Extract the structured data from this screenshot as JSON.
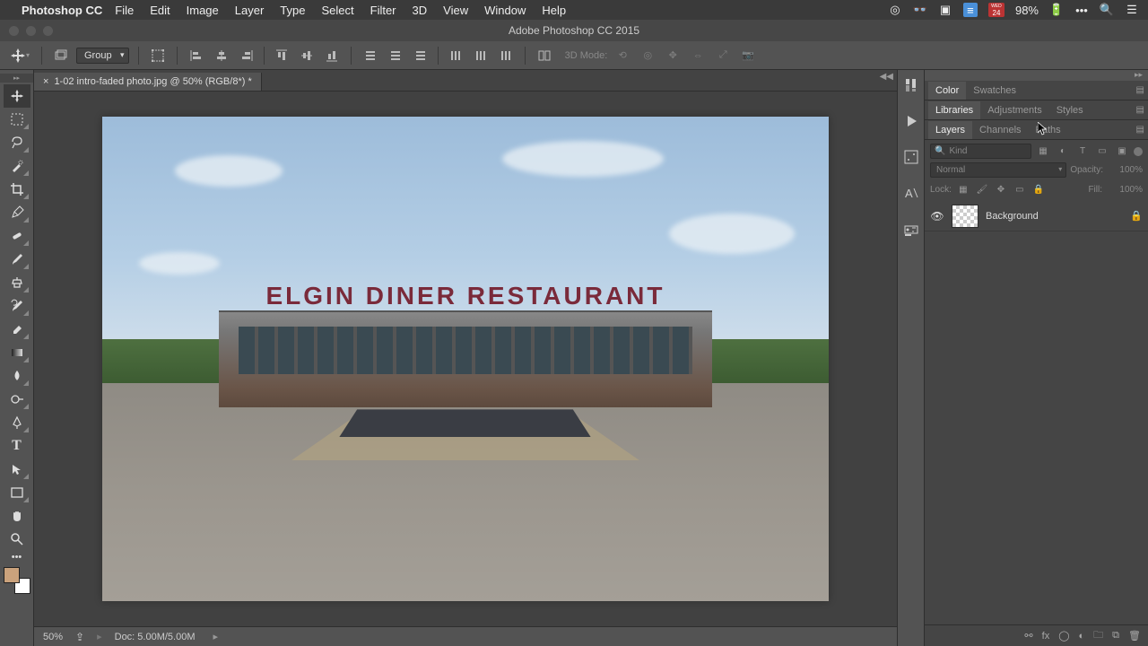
{
  "menubar": {
    "app": "Photoshop CC",
    "items": [
      "File",
      "Edit",
      "Image",
      "Layer",
      "Type",
      "Select",
      "Filter",
      "3D",
      "View",
      "Window",
      "Help"
    ],
    "battery": "98%",
    "date_dow": "WED",
    "date_day": "24"
  },
  "window": {
    "title": "Adobe Photoshop CC 2015"
  },
  "options": {
    "group_label": "Group",
    "mode3d_label": "3D Mode:"
  },
  "document": {
    "tab": "1-02 intro-faded photo.jpg @ 50% (RGB/8*) *",
    "sign_text": "ELGIN DINER RESTAURANT"
  },
  "status": {
    "zoom": "50%",
    "doc_info": "Doc: 5.00M/5.00M"
  },
  "panels": {
    "color_tab": "Color",
    "swatches_tab": "Swatches",
    "libraries_tab": "Libraries",
    "adjustments_tab": "Adjustments",
    "styles_tab": "Styles",
    "layers_tab": "Layers",
    "channels_tab": "Channels",
    "paths_tab": "Paths"
  },
  "layers": {
    "kind_placeholder": "Kind",
    "blend_mode": "Normal",
    "opacity_label": "Opacity:",
    "opacity_value": "100%",
    "lock_label": "Lock:",
    "fill_label": "Fill:",
    "fill_value": "100%",
    "items": [
      {
        "name": "Background",
        "locked": true
      }
    ]
  }
}
